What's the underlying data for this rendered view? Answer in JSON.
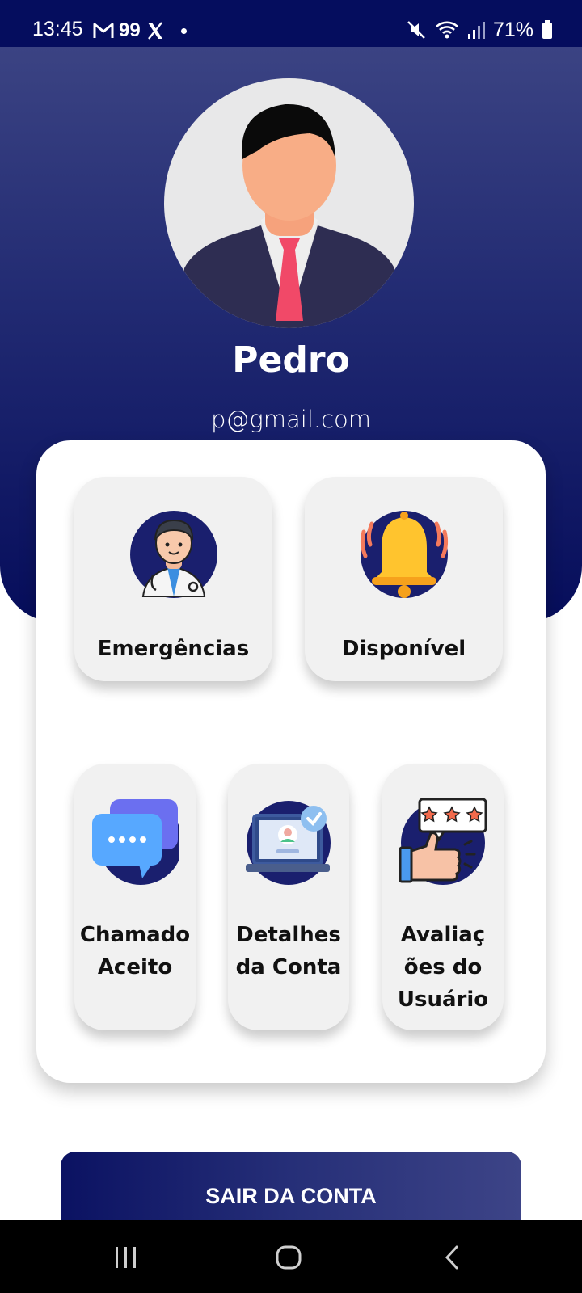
{
  "status_bar": {
    "time": "13:45",
    "left_icons": [
      "gmail-icon",
      "99-app-icon",
      "x-app-icon",
      "notification-dot"
    ],
    "app_99_label": "99",
    "battery_text": "71%",
    "right_icons": [
      "mute-icon",
      "wifi-icon",
      "signal-icon",
      "battery-icon"
    ]
  },
  "profile": {
    "name": "Pedro",
    "email": "p@gmail.com",
    "avatar_icon": "businessman-avatar-icon"
  },
  "tiles": [
    {
      "label": "Emergências",
      "icon": "doctor-icon"
    },
    {
      "label": "Disponível",
      "icon": "bell-icon"
    },
    {
      "label_lines": [
        "Chamado",
        "Aceito"
      ],
      "icon": "chat-bubbles-icon"
    },
    {
      "label_lines": [
        "Detalhes",
        "da Conta"
      ],
      "icon": "account-laptop-icon"
    },
    {
      "label_lines": [
        "Avaliaç",
        "ões do",
        "Usuário"
      ],
      "icon": "rating-thumbs-up-icon"
    }
  ],
  "logout_label": "SAIR DA CONTA",
  "nav_bar": [
    "recents-icon",
    "home-icon",
    "back-icon"
  ],
  "colors": {
    "header_top": "#3b4383",
    "header_bottom": "#060d5b",
    "status_bar": "#050d5e",
    "tile_bg": "#f1f1f1",
    "icon_circle": "#1a1f6e"
  }
}
